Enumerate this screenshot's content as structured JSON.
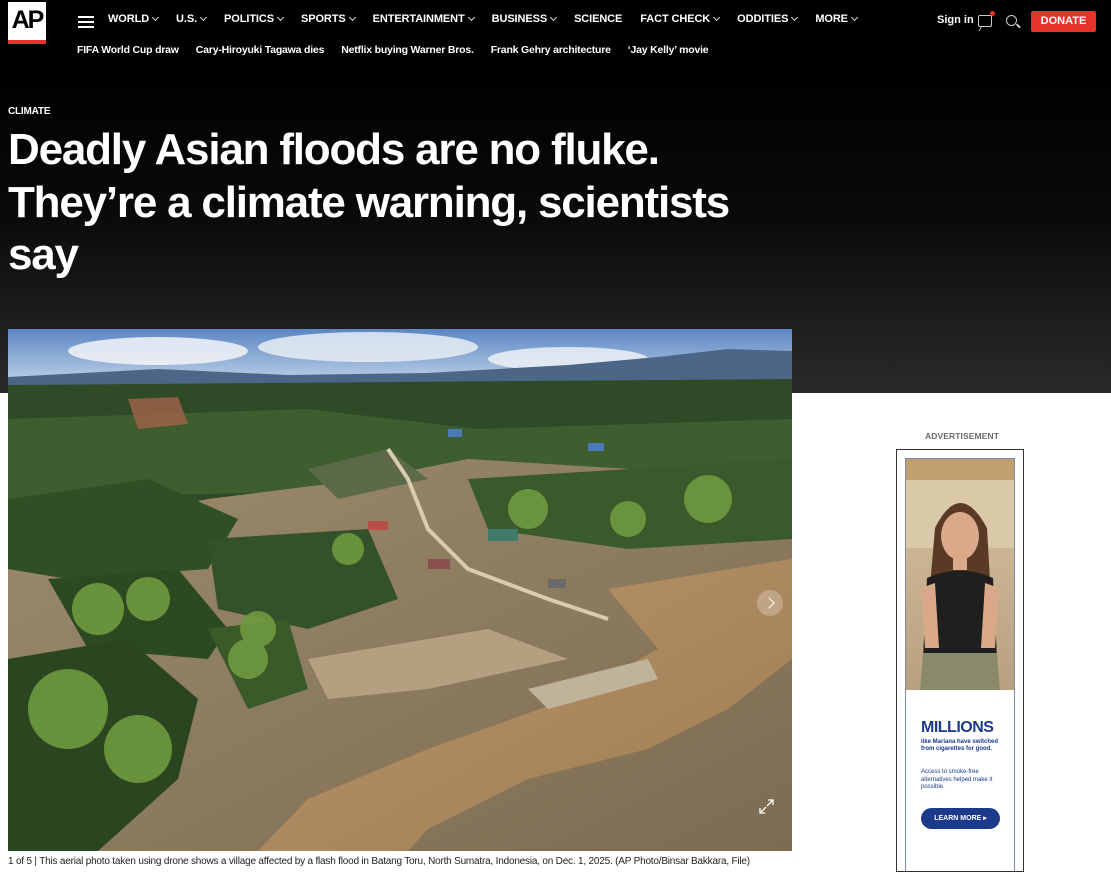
{
  "brand": {
    "logo_text": "AP",
    "accent": "#e8332b"
  },
  "nav": {
    "items": [
      {
        "label": "WORLD",
        "dropdown": true
      },
      {
        "label": "U.S.",
        "dropdown": true
      },
      {
        "label": "POLITICS",
        "dropdown": true
      },
      {
        "label": "SPORTS",
        "dropdown": true
      },
      {
        "label": "ENTERTAINMENT",
        "dropdown": true
      },
      {
        "label": "BUSINESS",
        "dropdown": true
      },
      {
        "label": "SCIENCE",
        "dropdown": false
      },
      {
        "label": "FACT CHECK",
        "dropdown": true
      },
      {
        "label": "ODDITIES",
        "dropdown": true
      },
      {
        "label": "MORE",
        "dropdown": true
      }
    ],
    "signin": "Sign in",
    "donate": "DONATE"
  },
  "trending": [
    "FIFA World Cup draw",
    "Cary-Hiroyuki Tagawa dies",
    "Netflix buying Warner Bros.",
    "Frank Gehry architecture",
    "‘Jay Kelly’ movie"
  ],
  "article": {
    "kicker": "CLIMATE",
    "headline": "Deadly Asian floods are no fluke. They’re a climate warning, scientists say",
    "caption_counter": "1 of 5 |",
    "caption": "This aerial photo taken using drone shows a village affected by a flash flood in Batang Toru, North Sumatra, Indonesia, on Dec. 1, 2025. (AP Photo/Binsar Bakkara, File)"
  },
  "ad": {
    "label": "ADVERTISEMENT",
    "title": "MILLIONS",
    "subtitle": "like Mariana have switched from cigarettes for good.",
    "body": "Access to smoke-free alternatives helped make it possible.",
    "cta": "LEARN MORE ▸"
  }
}
